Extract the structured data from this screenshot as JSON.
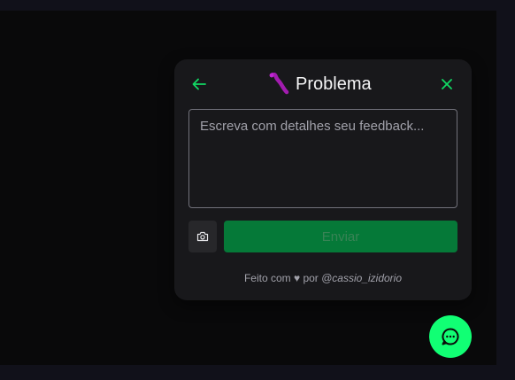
{
  "widget": {
    "title": "Problema",
    "back_icon": "arrow-left-icon",
    "close_icon": "x-close-icon",
    "type_icon": "bug-icon",
    "feedback": {
      "value": "",
      "placeholder": "Escreva com detalhes seu feedback..."
    },
    "screenshot_icon": "camera-icon",
    "submit_label": "Enviar",
    "footer": {
      "prefix": "Feito com ♥ por ",
      "author": "@cassio_izidorio"
    }
  },
  "fab": {
    "icon": "chat-bubble-icon"
  },
  "colors": {
    "accent": "#11ff74",
    "submit_bg": "#04843c",
    "widget_bg": "#18181b",
    "page_bg": "#09090a",
    "bug": "#a21caf"
  }
}
